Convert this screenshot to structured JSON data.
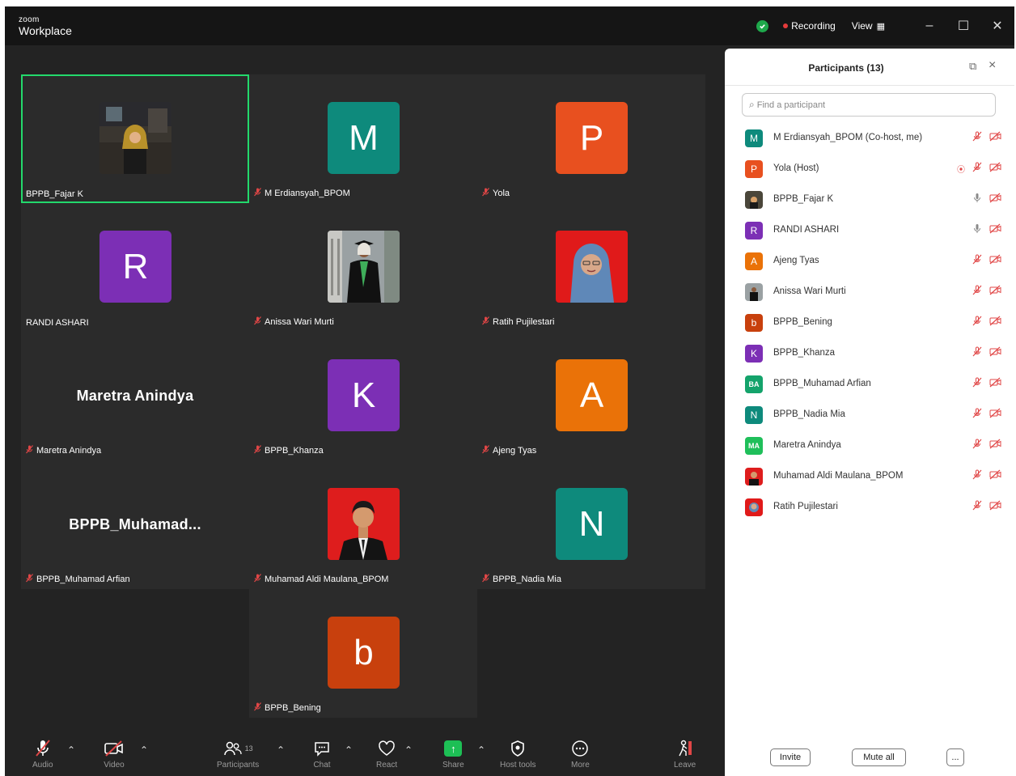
{
  "app": {
    "brand_small": "zoom",
    "brand_name": "Workplace"
  },
  "titlebar": {
    "recording_label": "Recording",
    "view_label": "View",
    "security_color": "#1ea84b",
    "recording_color": "#e53b3b"
  },
  "tiles": [
    {
      "name": "BPPB_Fajar K",
      "kind": "photo",
      "muted": false,
      "active": true
    },
    {
      "name": "M Erdiansyah_BPOM",
      "kind": "letter",
      "letter": "M",
      "color": "#0e8a7c",
      "muted": true
    },
    {
      "name": "Yola",
      "kind": "letter",
      "letter": "P",
      "color": "#e8501f",
      "muted": true
    },
    {
      "name": "RANDI ASHARI",
      "kind": "letter",
      "letter": "R",
      "color": "#7c2fb5",
      "muted": false
    },
    {
      "name": "Anissa Wari Murti",
      "kind": "photo",
      "muted": true
    },
    {
      "name": "Ratih Pujilestari",
      "kind": "photo",
      "muted": true
    },
    {
      "name": "Maretra Anindya",
      "kind": "text",
      "display": "Maretra Anindya",
      "muted": true
    },
    {
      "name": "BPPB_Khanza",
      "kind": "letter",
      "letter": "K",
      "color": "#7c2fb5",
      "muted": true
    },
    {
      "name": "Ajeng Tyas",
      "kind": "letter",
      "letter": "A",
      "color": "#ea7208",
      "muted": true
    },
    {
      "name": "BPPB_Muhamad Arfian",
      "kind": "text",
      "display": "BPPB_Muhamad...",
      "muted": true
    },
    {
      "name": "Muhamad Aldi Maulana_BPOM",
      "kind": "photo",
      "muted": true
    },
    {
      "name": "BPPB_Nadia Mia",
      "kind": "letter",
      "letter": "N",
      "color": "#0e8a7c",
      "muted": true
    },
    {
      "name": "BPPB_Bening",
      "kind": "letter",
      "letter": "b",
      "color": "#c8400d",
      "muted": true
    }
  ],
  "panel": {
    "title": "Participants (13)",
    "search_placeholder": "Find a participant",
    "participants": [
      {
        "name": "M Erdiansyah_BPOM (Co-host, me)",
        "avatar": "M",
        "color": "#0e8a7c",
        "mic": "off",
        "recording": false
      },
      {
        "name": "Yola (Host)",
        "avatar": "P",
        "color": "#e8501f",
        "mic": "off",
        "recording": true
      },
      {
        "name": "BPPB_Fajar K",
        "avatar": "",
        "color": "#5a5a3a",
        "mic": "on",
        "recording": false
      },
      {
        "name": "RANDI ASHARI",
        "avatar": "R",
        "color": "#7c2fb5",
        "mic": "on",
        "recording": false
      },
      {
        "name": "Ajeng Tyas",
        "avatar": "A",
        "color": "#ea7208",
        "mic": "off",
        "recording": false
      },
      {
        "name": "Anissa Wari Murti",
        "avatar": "",
        "color": "#6b6b6b",
        "mic": "off",
        "recording": false
      },
      {
        "name": "BPPB_Bening",
        "avatar": "b",
        "color": "#c8400d",
        "mic": "off",
        "recording": false
      },
      {
        "name": "BPPB_Khanza",
        "avatar": "K",
        "color": "#7c2fb5",
        "mic": "off",
        "recording": false
      },
      {
        "name": "BPPB_Muhamad Arfian",
        "avatar": "BA",
        "color": "#14a36b",
        "mic": "off",
        "recording": false
      },
      {
        "name": "BPPB_Nadia Mia",
        "avatar": "N",
        "color": "#0e8a7c",
        "mic": "off",
        "recording": false
      },
      {
        "name": "Maretra Anindya",
        "avatar": "MA",
        "color": "#1fbf5a",
        "mic": "off",
        "recording": false
      },
      {
        "name": "Muhamad Aldi Maulana_BPOM",
        "avatar": "",
        "color": "#c0201e",
        "mic": "off",
        "recording": false
      },
      {
        "name": "Ratih Pujilestari",
        "avatar": "",
        "color": "#c83030",
        "mic": "off",
        "recording": false
      }
    ],
    "invite_label": "Invite",
    "mute_all_label": "Mute all",
    "more_label": "..."
  },
  "toolbar": {
    "audio": "Audio",
    "video": "Video",
    "participants": "Participants",
    "participants_count": "13",
    "chat": "Chat",
    "react": "React",
    "share": "Share",
    "host_tools": "Host tools",
    "more": "More",
    "leave": "Leave"
  }
}
